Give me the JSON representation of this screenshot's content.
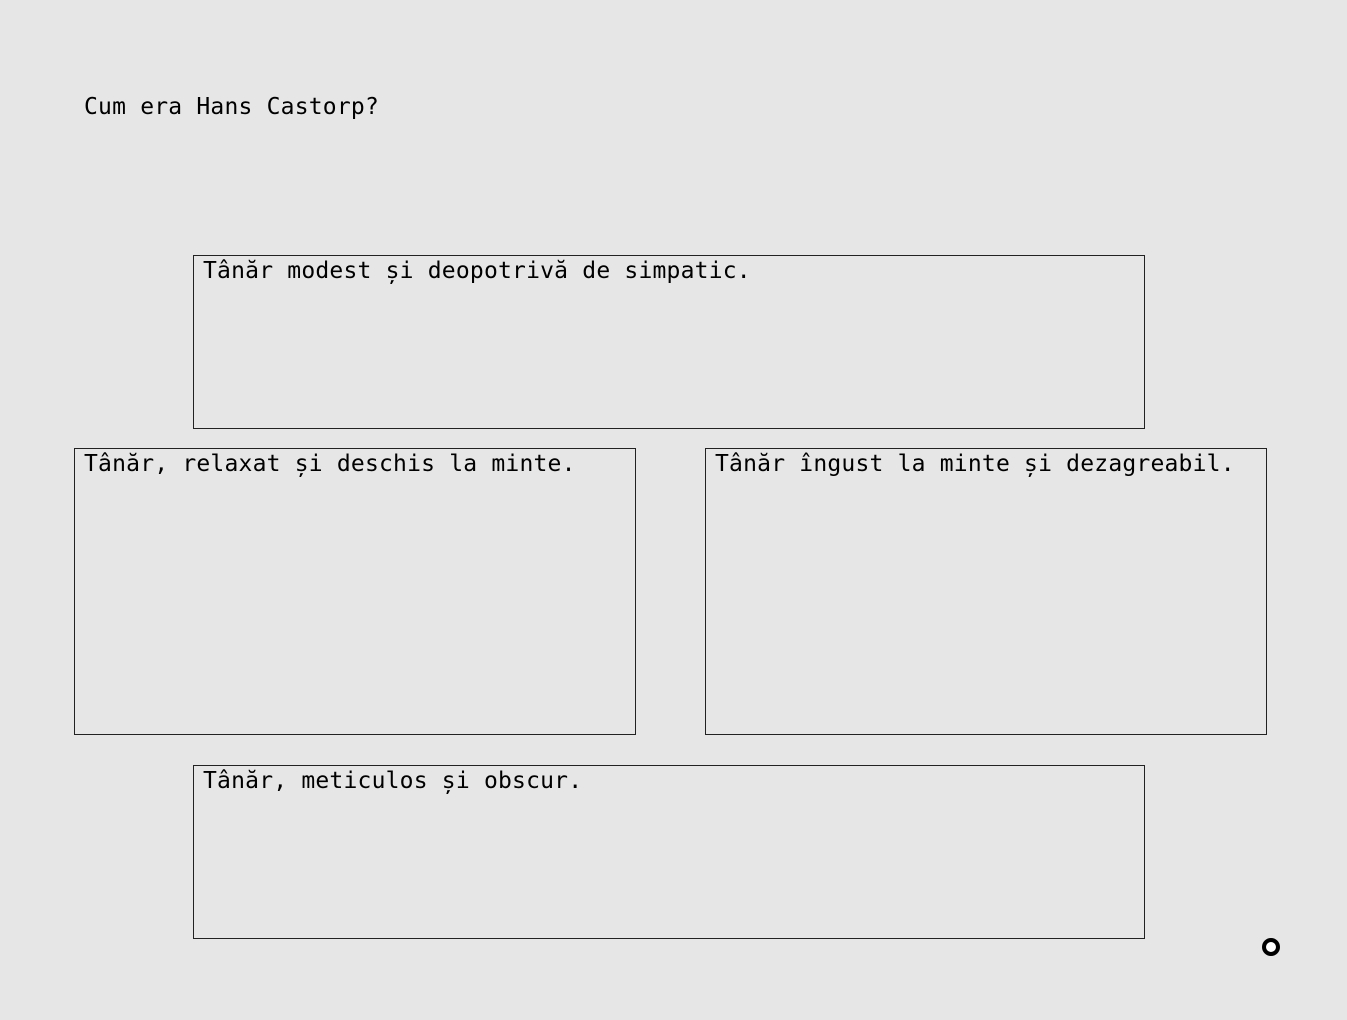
{
  "question": "Cum era Hans Castorp?",
  "options": [
    {
      "label": "Tânăr modest și deopotrivă de simpatic."
    },
    {
      "label": "Tânăr, relaxat și deschis la minte."
    },
    {
      "label": "Tânăr îngust la minte și dezagreabil."
    },
    {
      "label": "Tânăr, meticulos și obscur."
    }
  ],
  "indicator": {
    "icon": "ring-icon"
  }
}
